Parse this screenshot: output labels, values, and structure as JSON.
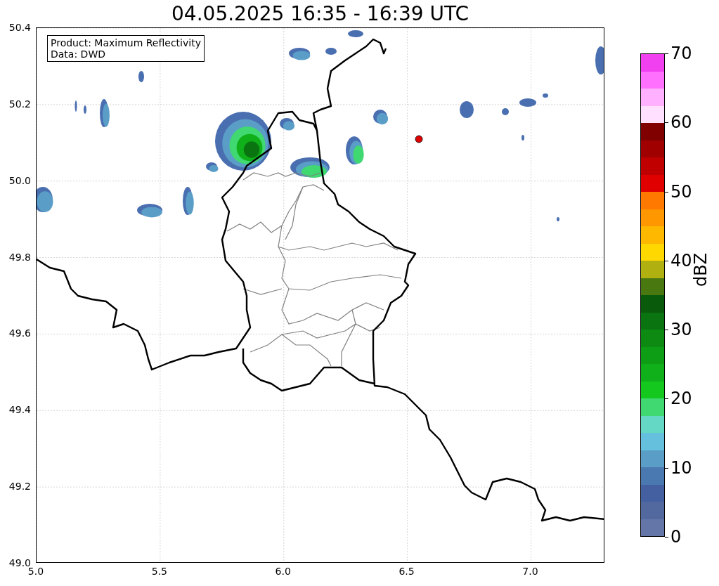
{
  "title": "04.05.2025 16:35 - 16:39 UTC",
  "info_box": {
    "lines": [
      "Product: Maximum Reflectivity",
      "Data: DWD"
    ]
  },
  "x_ticks": [
    "5.0",
    "5.5",
    "6.0",
    "6.5",
    "7.0"
  ],
  "y_ticks": [
    "50.4",
    "50.2",
    "50.0",
    "49.8",
    "49.6",
    "49.4",
    "49.2",
    "49.0"
  ],
  "colorbar": {
    "label": "dBZ",
    "ticks": [
      "70",
      "60",
      "50",
      "40",
      "30",
      "20",
      "10",
      "0"
    ],
    "bands": [
      {
        "color": "#6476a8"
      },
      {
        "color": "#52699f"
      },
      {
        "color": "#4460a0"
      },
      {
        "color": "#4a78b0"
      },
      {
        "color": "#5a9ec8"
      },
      {
        "color": "#64c0dc"
      },
      {
        "color": "#64d8c4"
      },
      {
        "color": "#40d870"
      },
      {
        "color": "#14c81e"
      },
      {
        "color": "#10b01a"
      },
      {
        "color": "#0e9e16"
      },
      {
        "color": "#0c8a12"
      },
      {
        "color": "#0a7410"
      },
      {
        "color": "#0a5a0c"
      },
      {
        "color": "#4a7810"
      },
      {
        "color": "#b0b010"
      },
      {
        "color": "#ffd800"
      },
      {
        "color": "#ffb800"
      },
      {
        "color": "#ff9800"
      },
      {
        "color": "#ff7800"
      },
      {
        "color": "#e00000"
      },
      {
        "color": "#c00000"
      },
      {
        "color": "#a00000"
      },
      {
        "color": "#800000"
      },
      {
        "color": "#ffe0ff"
      },
      {
        "color": "#ffb0ff"
      },
      {
        "color": "#ff70ff"
      },
      {
        "color": "#f040f0"
      }
    ]
  }
}
